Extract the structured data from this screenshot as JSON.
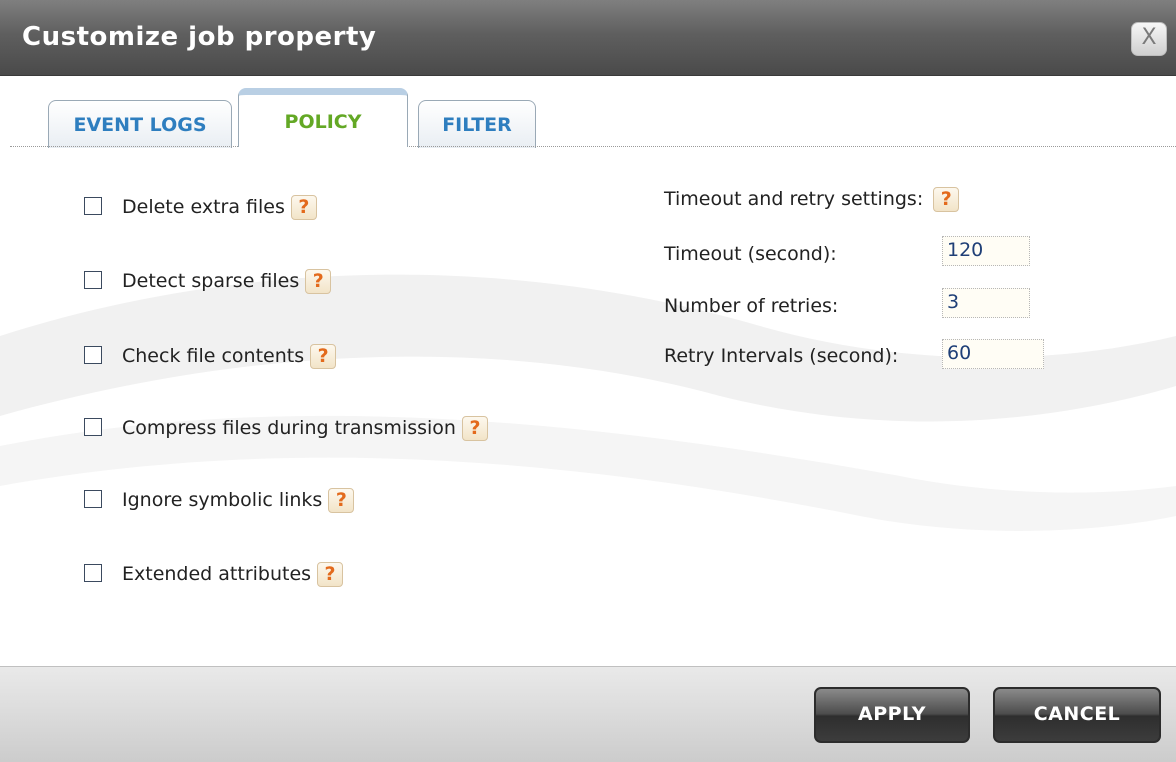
{
  "dialog": {
    "title": "Customize job property",
    "close_label": "X"
  },
  "tabs": [
    {
      "label": "EVENT LOGS",
      "active": false
    },
    {
      "label": "POLICY",
      "active": true
    },
    {
      "label": "FILTER",
      "active": false
    }
  ],
  "policy_options": [
    {
      "label": "Delete extra files",
      "checked": false
    },
    {
      "label": "Detect sparse files",
      "checked": false
    },
    {
      "label": "Check file contents",
      "checked": false
    },
    {
      "label": "Compress files during transmission",
      "checked": false
    },
    {
      "label": "Ignore symbolic links",
      "checked": false
    },
    {
      "label": "Extended attributes",
      "checked": false
    }
  ],
  "timeout_settings": {
    "heading": "Timeout and retry settings:",
    "timeout_label": "Timeout (second):",
    "timeout_value": "120",
    "retries_label": "Number of retries:",
    "retries_value": "3",
    "interval_label": "Retry Intervals (second):",
    "interval_value": "60"
  },
  "help_glyph": "?",
  "footer": {
    "apply_label": "APPLY",
    "cancel_label": "CANCEL"
  },
  "colors": {
    "tab_active_text": "#63a825",
    "tab_text": "#2e7ebf",
    "help_icon": "#e36a1c",
    "titlebar": "#5f5f5f"
  },
  "icons": {
    "help": "help-icon",
    "close": "close-icon",
    "checkbox": "checkbox-icon"
  }
}
